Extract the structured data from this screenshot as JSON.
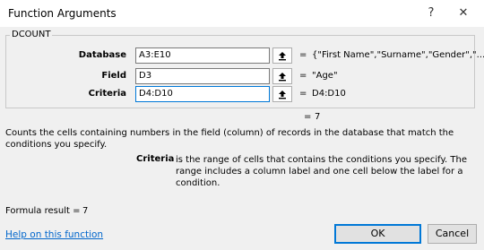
{
  "window": {
    "title": "Function Arguments",
    "help_glyph": "?",
    "close_glyph": "✕"
  },
  "group": {
    "title": "DCOUNT"
  },
  "args": [
    {
      "label": "Database",
      "value": "A3:E10",
      "preview": "{\"First Name\",\"Surname\",\"Gender\",\"..."
    },
    {
      "label": "Field",
      "value": "D3",
      "preview": "\"Age\""
    },
    {
      "label": "Criteria",
      "value": "D4:D10",
      "preview": "D4:D10"
    }
  ],
  "equals": "=",
  "result_preview": "7",
  "description": "Counts the cells containing numbers in the field (column) of records in the database that match the conditions you specify.",
  "current_arg": {
    "name": "Criteria",
    "description": "is the range of cells that contains the conditions you specify. The range includes a column label and one cell below the label for a condition."
  },
  "formula_result": {
    "label": "Formula result =",
    "value": "7"
  },
  "help_link": "Help on this function",
  "buttons": {
    "ok": "OK",
    "cancel": "Cancel"
  },
  "icons": {
    "collapse": "collapse-dialog-icon"
  },
  "colors": {
    "accent": "#0078d7",
    "link": "#0066cc"
  }
}
